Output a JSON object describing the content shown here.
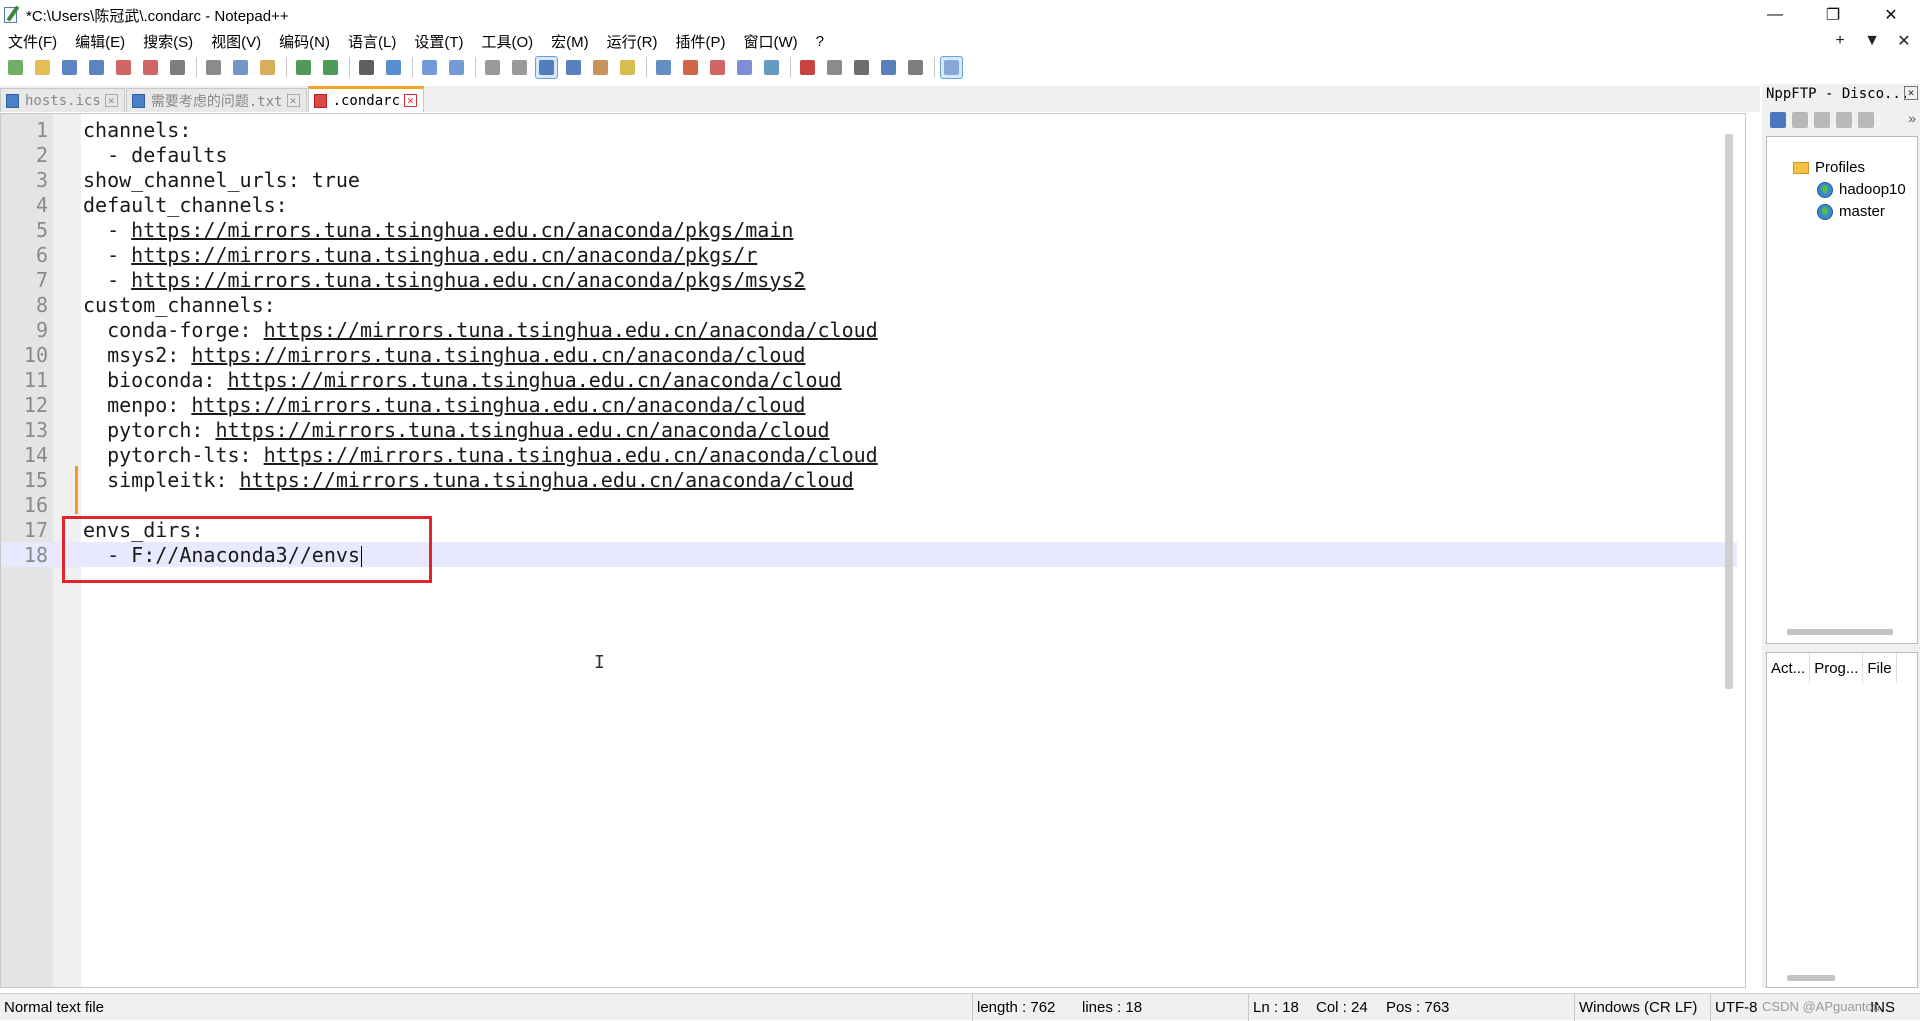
{
  "window": {
    "title": "*C:\\Users\\陈冠武\\.condarc - Notepad++",
    "controls": {
      "minimize": "—",
      "maximize": "❐",
      "close": "✕"
    }
  },
  "menu": {
    "items": [
      "文件(F)",
      "编辑(E)",
      "搜索(S)",
      "视图(V)",
      "编码(N)",
      "语言(L)",
      "设置(T)",
      "工具(O)",
      "宏(M)",
      "运行(R)",
      "插件(P)",
      "窗口(W)",
      "?"
    ],
    "right": [
      "+",
      "▼",
      "✕"
    ]
  },
  "tabs": [
    {
      "label": "hosts.ics",
      "icon": "saved-file-icon",
      "close": "✕",
      "active": false
    },
    {
      "label": "需要考虑的问题.txt",
      "icon": "saved-file-icon",
      "close": "✕",
      "active": false
    },
    {
      "label": ".condarc",
      "icon": "unsaved-file-icon",
      "close": "✕",
      "active": true
    }
  ],
  "editor": {
    "lines": [
      {
        "n": "1",
        "segments": [
          {
            "t": "channels:"
          }
        ]
      },
      {
        "n": "2",
        "segments": [
          {
            "t": "  - defaults"
          }
        ]
      },
      {
        "n": "3",
        "segments": [
          {
            "t": "show_channel_urls: true"
          }
        ]
      },
      {
        "n": "4",
        "segments": [
          {
            "t": "default_channels:"
          }
        ]
      },
      {
        "n": "5",
        "segments": [
          {
            "t": "  - "
          },
          {
            "t": "https://mirrors.tuna.tsinghua.edu.cn/anaconda/pkgs/main",
            "url": true
          }
        ]
      },
      {
        "n": "6",
        "segments": [
          {
            "t": "  - "
          },
          {
            "t": "https://mirrors.tuna.tsinghua.edu.cn/anaconda/pkgs/r",
            "url": true
          }
        ]
      },
      {
        "n": "7",
        "segments": [
          {
            "t": "  - "
          },
          {
            "t": "https://mirrors.tuna.tsinghua.edu.cn/anaconda/pkgs/msys2",
            "url": true
          }
        ]
      },
      {
        "n": "8",
        "segments": [
          {
            "t": "custom_channels:"
          }
        ]
      },
      {
        "n": "9",
        "segments": [
          {
            "t": "  conda-forge: "
          },
          {
            "t": "https://mirrors.tuna.tsinghua.edu.cn/anaconda/cloud",
            "url": true
          }
        ]
      },
      {
        "n": "10",
        "segments": [
          {
            "t": "  msys2: "
          },
          {
            "t": "https://mirrors.tuna.tsinghua.edu.cn/anaconda/cloud",
            "url": true
          }
        ]
      },
      {
        "n": "11",
        "segments": [
          {
            "t": "  bioconda: "
          },
          {
            "t": "https://mirrors.tuna.tsinghua.edu.cn/anaconda/cloud",
            "url": true
          }
        ]
      },
      {
        "n": "12",
        "segments": [
          {
            "t": "  menpo: "
          },
          {
            "t": "https://mirrors.tuna.tsinghua.edu.cn/anaconda/cloud",
            "url": true
          }
        ]
      },
      {
        "n": "13",
        "segments": [
          {
            "t": "  pytorch: "
          },
          {
            "t": "https://mirrors.tuna.tsinghua.edu.cn/anaconda/cloud",
            "url": true
          }
        ]
      },
      {
        "n": "14",
        "segments": [
          {
            "t": "  pytorch-lts: "
          },
          {
            "t": "https://mirrors.tuna.tsinghua.edu.cn/anaconda/cloud",
            "url": true
          }
        ]
      },
      {
        "n": "15",
        "segments": [
          {
            "t": "  simpleitk: "
          },
          {
            "t": "https://mirrors.tuna.tsinghua.edu.cn/anaconda/cloud",
            "url": true
          }
        ]
      },
      {
        "n": "16",
        "segments": [
          {
            "t": ""
          }
        ]
      },
      {
        "n": "17",
        "segments": [
          {
            "t": "envs_dirs:"
          }
        ]
      },
      {
        "n": "18",
        "segments": [
          {
            "t": "  - F://Anaconda3//envs"
          }
        ],
        "current": true
      }
    ],
    "ibeam": "I"
  },
  "ftp": {
    "title": "NppFTP - Disco...",
    "close": "✕",
    "more": "»",
    "tree": {
      "root": "Profiles",
      "children": [
        "hadoop10",
        "master"
      ]
    },
    "queue_columns": [
      "Act...",
      "Prog...",
      "File"
    ]
  },
  "status": {
    "filetype": "Normal text file",
    "length": "length : 762",
    "lines": "lines : 18",
    "ln": "Ln : 18",
    "col": "Col : 24",
    "pos": "Pos : 763",
    "eol": "Windows (CR LF)",
    "encoding": "UTF-8",
    "mode": "INS"
  },
  "watermark": "CSDN @APguantou",
  "colors": {
    "current_line": "#e8e8ff",
    "highlight_box": "#e0262a",
    "active_tab_accent": "#f4a020",
    "change_marker": "#f39a1a"
  },
  "toolbar_icons": [
    "new-file-icon",
    "open-file-icon",
    "save-icon",
    "save-all-icon",
    "close-icon",
    "close-all-icon",
    "print-icon",
    "cut-icon",
    "copy-icon",
    "paste-icon",
    "undo-icon",
    "redo-icon",
    "find-icon",
    "replace-icon",
    "zoom-in-icon",
    "zoom-out-icon",
    "sync-vertical-icon",
    "sync-horizontal-icon",
    "word-wrap-icon",
    "show-all-chars-icon",
    "indent-guide-icon",
    "udl-icon",
    "doc-map-icon",
    "function-list-icon",
    "folder-workspace-icon",
    "doc-list-icon",
    "monitoring-icon",
    "record-macro-icon",
    "stop-record-icon",
    "play-macro-icon",
    "run-macro-multiple-icon",
    "save-macro-icon",
    "nppftp-icon"
  ]
}
